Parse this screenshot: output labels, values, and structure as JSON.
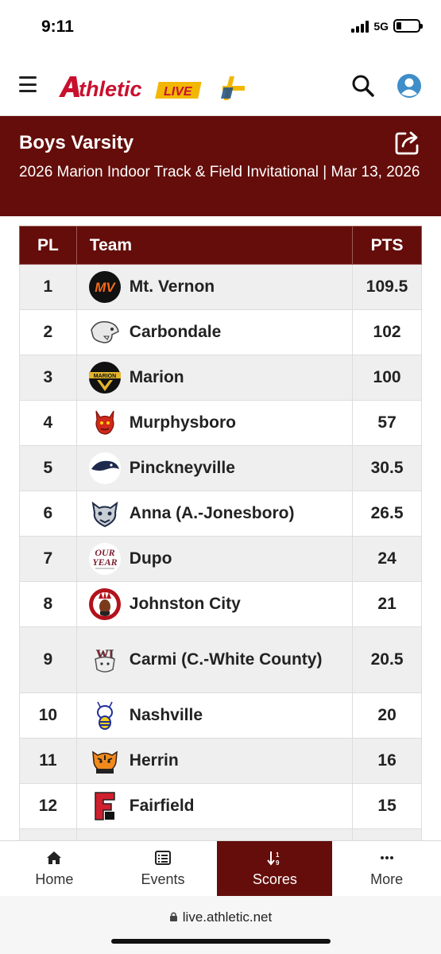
{
  "status": {
    "time": "9:11",
    "network": "5G"
  },
  "header": {
    "logo_text": "thletic",
    "logo_badge": "LIVE"
  },
  "meet": {
    "title": "Boys Varsity",
    "subtitle": "2026 Marion Indoor Track & Field Invitational | Mar 13, 2026"
  },
  "table": {
    "headers": {
      "pl": "PL",
      "team": "Team",
      "pts": "PTS"
    },
    "rows": [
      {
        "pl": "1",
        "team": "Mt. Vernon",
        "pts": "109.5",
        "logo": "mt-vernon-logo"
      },
      {
        "pl": "2",
        "team": "Carbondale",
        "pts": "102",
        "logo": "carbondale-logo"
      },
      {
        "pl": "3",
        "team": "Marion",
        "pts": "100",
        "logo": "marion-logo"
      },
      {
        "pl": "4",
        "team": "Murphysboro",
        "pts": "57",
        "logo": "murphysboro-logo"
      },
      {
        "pl": "5",
        "team": "Pinckneyville",
        "pts": "30.5",
        "logo": "pinckneyville-logo"
      },
      {
        "pl": "6",
        "team": "Anna (A.-Jonesboro)",
        "pts": "26.5",
        "logo": "anna-jonesboro-logo"
      },
      {
        "pl": "7",
        "team": "Dupo",
        "pts": "24",
        "logo": "dupo-logo"
      },
      {
        "pl": "8",
        "team": "Johnston City",
        "pts": "21",
        "logo": "johnston-city-logo"
      },
      {
        "pl": "9",
        "team": "Carmi (C.-White County)",
        "pts": "20.5",
        "logo": "carmi-logo"
      },
      {
        "pl": "10",
        "team": "Nashville",
        "pts": "20",
        "logo": "nashville-logo"
      },
      {
        "pl": "11",
        "team": "Herrin",
        "pts": "16",
        "logo": "herrin-logo"
      },
      {
        "pl": "12",
        "team": "Fairfield",
        "pts": "15",
        "logo": "fairfield-logo"
      }
    ]
  },
  "nav": {
    "home": "Home",
    "events": "Events",
    "scores": "Scores",
    "more": "More"
  },
  "browser": {
    "url": "live.athletic.net"
  },
  "colors": {
    "brand": "#640d0a",
    "logo_red": "#c8102e",
    "logo_yellow": "#f2b705"
  }
}
